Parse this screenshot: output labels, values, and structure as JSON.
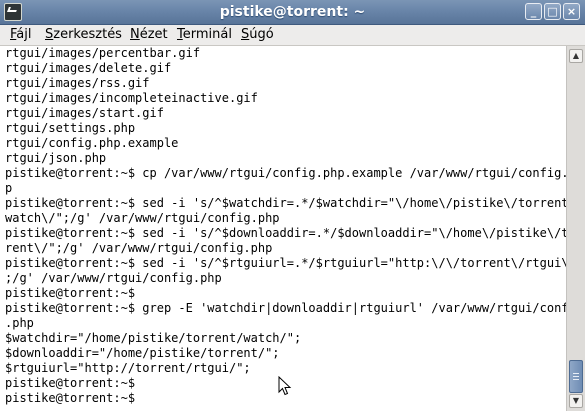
{
  "window": {
    "title": "pistike@torrent: ~",
    "buttons": {
      "minimize": "_",
      "maximize": "□",
      "close": "×"
    }
  },
  "menu": [
    {
      "key": "F",
      "rest": "ájl"
    },
    {
      "key": "S",
      "rest": "zerkesztés"
    },
    {
      "key": "N",
      "rest": "ézet"
    },
    {
      "key": "T",
      "rest": "erminál"
    },
    {
      "key": "S",
      "rest": "úgó"
    }
  ],
  "terminal": {
    "lines": [
      "rtgui/images/percentbar.gif",
      "rtgui/images/delete.gif",
      "rtgui/images/rss.gif",
      "rtgui/images/incompleteinactive.gif",
      "rtgui/images/start.gif",
      "rtgui/settings.php",
      "rtgui/config.php.example",
      "rtgui/json.php",
      "pistike@torrent:~$ cp /var/www/rtgui/config.php.example /var/www/rtgui/config.ph",
      "p",
      "pistike@torrent:~$ sed -i 's/^$watchdir=.*/$watchdir=\"\\/home\\/pistike\\/torrent\\/",
      "watch\\/\";/g' /var/www/rtgui/config.php",
      "pistike@torrent:~$ sed -i 's/^$downloaddir=.*/$downloaddir=\"\\/home\\/pistike\\/tor",
      "rent\\/\";/g' /var/www/rtgui/config.php",
      "pistike@torrent:~$ sed -i 's/^$rtguiurl=.*/$rtguiurl=\"http:\\/\\/torrent\\/rtgui\\/\"",
      ";/g' /var/www/rtgui/config.php",
      "pistike@torrent:~$",
      "pistike@torrent:~$ grep -E 'watchdir|downloaddir|rtguiurl' /var/www/rtgui/config",
      ".php",
      "$watchdir=\"/home/pistike/torrent/watch/\";",
      "$downloaddir=\"/home/pistike/torrent/\";",
      "$rtguiurl=\"http://torrent/rtgui/\";",
      "pistike@torrent:~$",
      "pistike@torrent:~$"
    ]
  }
}
